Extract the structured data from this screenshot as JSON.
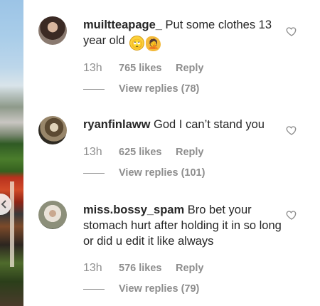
{
  "comments": [
    {
      "username": "muiltteapage_",
      "text": " Put some clothes 13 year old",
      "emojis": [
        "🙄",
        "🤦"
      ],
      "time": "13h",
      "likes": "765 likes",
      "reply_label": "Reply",
      "view_replies": "View replies (78)"
    },
    {
      "username": "ryanfinlaww",
      "text": " God I can’t stand you",
      "time": "13h",
      "likes": "625 likes",
      "reply_label": "Reply",
      "view_replies": "View replies (101)"
    },
    {
      "username": "miss.bossy_spam",
      "text": " Bro bet your stomach hurt after holding it in so long or did u edit it like always",
      "time": "13h",
      "likes": "576 likes",
      "reply_label": "Reply",
      "view_replies": "View replies (79)"
    }
  ],
  "icons": {
    "like": "heart-outline-icon",
    "nav": "chevron-left-icon"
  },
  "colors": {
    "text": "#262626",
    "secondary": "#8e8e8e"
  }
}
